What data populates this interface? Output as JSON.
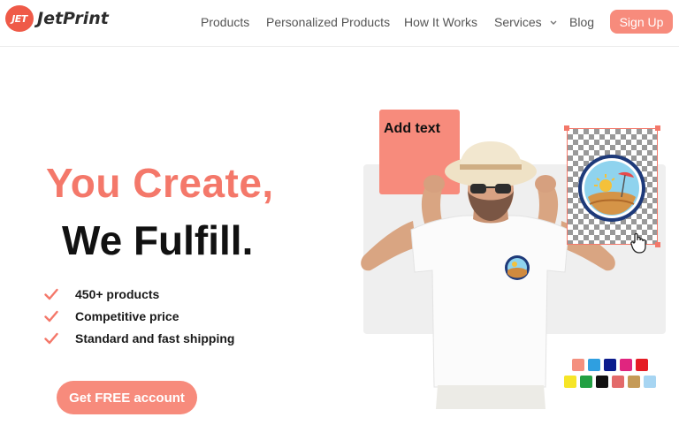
{
  "brand": {
    "logo_badge": "JET",
    "logo_text": "JetPrint",
    "accent": "#f4786a"
  },
  "nav": {
    "items": [
      {
        "label": "Products"
      },
      {
        "label": "Personalized Products"
      },
      {
        "label": "How It Works"
      },
      {
        "label": "Services"
      },
      {
        "label": "Blog"
      }
    ],
    "signup_label": "Sign Up"
  },
  "hero": {
    "title_line1": "You Create,",
    "title_line2": "We Fulfill.",
    "features": [
      {
        "text": "450+ products",
        "icon": "check-icon"
      },
      {
        "text": "Competitive price",
        "icon": "check-icon"
      },
      {
        "text": "Standard and fast shipping",
        "icon": "check-icon"
      }
    ],
    "cta_label": "Get FREE account"
  },
  "editor": {
    "add_text_label": "Add text",
    "swatch_colors": [
      "#f4907f",
      "#2f9fe0",
      "#0b1b8c",
      "#e0257f",
      "#e51c24",
      "#f6e527",
      "#22a043",
      "#111111",
      "#e36a6a",
      "#c59a57",
      "#a7d5f2"
    ]
  }
}
